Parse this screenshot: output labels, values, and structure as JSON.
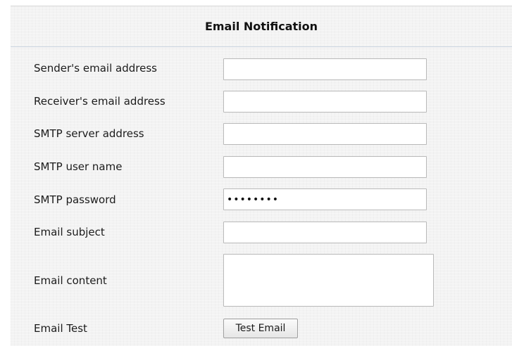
{
  "section": {
    "title": "Email Notification"
  },
  "fields": {
    "sender": {
      "label": "Sender's email address",
      "value": ""
    },
    "receiver": {
      "label": "Receiver's email address",
      "value": ""
    },
    "smtp_server": {
      "label": "SMTP server address",
      "value": ""
    },
    "smtp_user": {
      "label": "SMTP user name",
      "value": ""
    },
    "smtp_password": {
      "label": "SMTP password",
      "value": "********"
    },
    "subject": {
      "label": "Email subject",
      "value": ""
    },
    "content": {
      "label": "Email content",
      "value": ""
    }
  },
  "test": {
    "label": "Email Test",
    "button_label": "Test Email"
  }
}
